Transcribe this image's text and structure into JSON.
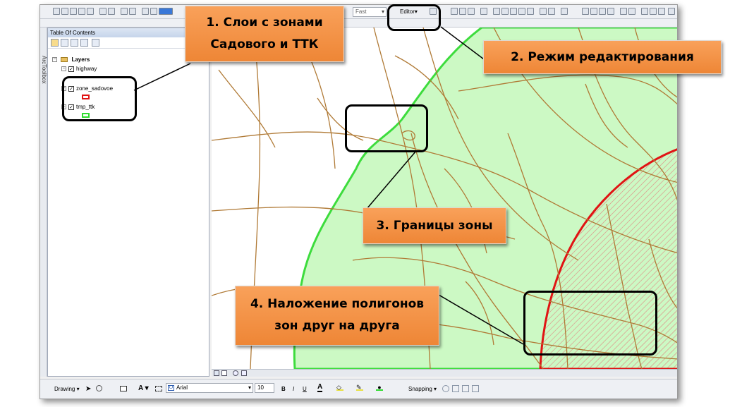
{
  "toolbar": {
    "speed_combo": "Fast",
    "editor_label": "Editor▾"
  },
  "toc": {
    "title": "Table Of Contents",
    "toolbox_label": "ArcToolbox",
    "root_label": "Layers",
    "layers": [
      {
        "label": "highway"
      },
      {
        "label": "zone_sadovoe",
        "symbol_color": "#e01414"
      },
      {
        "label": "tmp_ttk",
        "symbol_color": "#2edc2e"
      }
    ]
  },
  "map": {
    "zone_fill": "#ccf9c4",
    "zone_outline": "#3ddc3d",
    "overlap_outline": "#e01414",
    "road_color": "#b07a36"
  },
  "drawing_bar": {
    "drawing_label": "Drawing ▾",
    "text_tool": "A ▾",
    "font_name": "Arial",
    "font_size": "10",
    "bold": "B",
    "italic": "I",
    "underline": "U",
    "snapping_label": "Snapping ▾"
  },
  "callouts": {
    "c1_line1": "1. Слои с зонами",
    "c1_line2": "Садового и ТТК",
    "c2": "2. Режим редактирования",
    "c3": "3. Границы зоны",
    "c4_line1": "4. Наложение полигонов",
    "c4_line2": "зон друг на друга"
  },
  "colors": {
    "callout_fill": "#f0893a"
  }
}
